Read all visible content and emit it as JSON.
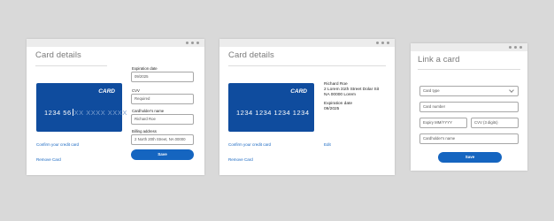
{
  "window1": {
    "title": "Card details",
    "card": {
      "brand": "CARD",
      "typed": "1234 56",
      "placeholder": "XX XXXX XXXX"
    },
    "confirm_link": "Confirm your credit card",
    "remove_link": "Remove Card",
    "expiration": {
      "label": "Expiration date",
      "value": "09/2025"
    },
    "cvv": {
      "label": "CVV",
      "value": "Required"
    },
    "name": {
      "label": "Cardholder's name",
      "value": "Richard Roe"
    },
    "address": {
      "label": "Billing address",
      "value": "2 North 20th Street, NA 00000"
    },
    "save_button": "Save"
  },
  "window2": {
    "title": "Card details",
    "card": {
      "brand": "CARD",
      "number": "1234  1234  1234  1234"
    },
    "holder_name": "Richard Roe",
    "address_line1": "2 Lorem 31th Street Dolar Sit",
    "address_line2": "NA 00000 Lorem",
    "expiration_label": "Expiration date",
    "expiration_value": "09/2025",
    "confirm_link": "Confirm your credit card",
    "remove_link": "Remove Card",
    "edit_link": "Edit"
  },
  "window3": {
    "title": "Link a card",
    "card_type_placeholder": "Card type",
    "card_number_placeholder": "Card number",
    "expiry_placeholder": "Expiry MM/YYYY",
    "cvv_placeholder": "CVV (3 digits)",
    "name_placeholder": "Cardholder's name",
    "save_button": "Save"
  }
}
